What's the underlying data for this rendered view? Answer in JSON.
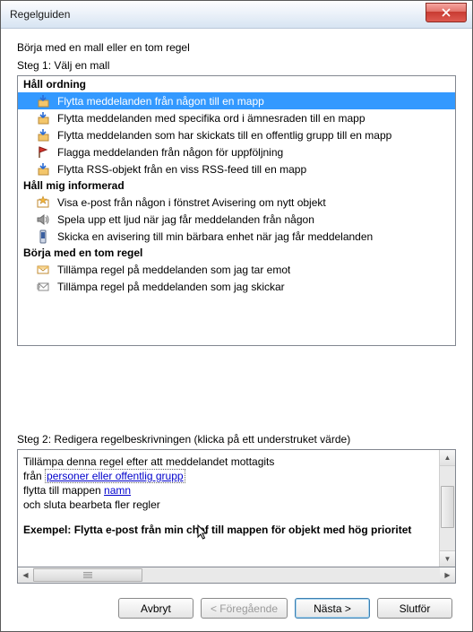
{
  "window": {
    "title": "Regelguiden"
  },
  "intro": "Börja med en mall eller en tom regel",
  "step1_label": "Steg 1: Välj en mall",
  "groups": {
    "g1": "Håll ordning",
    "g2": "Håll mig informerad",
    "g3": "Börja med en tom regel"
  },
  "items": {
    "i1": "Flytta meddelanden från någon till en mapp",
    "i2": "Flytta meddelanden med specifika ord i ämnesraden till en mapp",
    "i3": "Flytta meddelanden som har skickats till en offentlig grupp till en mapp",
    "i4": "Flagga meddelanden från någon för uppföljning",
    "i5": "Flytta RSS-objekt från en viss RSS-feed till en mapp",
    "i6": "Visa e-post från någon i fönstret Avisering om nytt objekt",
    "i7": "Spela upp ett ljud när jag får meddelanden från någon",
    "i8": "Skicka en avisering till min bärbara enhet när jag får meddelanden",
    "i9": "Tillämpa regel på meddelanden som jag tar emot",
    "i10": "Tillämpa regel på meddelanden som jag skickar"
  },
  "step2_label": "Steg 2: Redigera regelbeskrivningen (klicka på ett understruket värde)",
  "desc": {
    "line1": "Tillämpa denna regel efter att meddelandet mottagits",
    "line2_prefix": "från ",
    "line2_link": "personer eller offentlig grupp",
    "line3_prefix": "flytta till mappen ",
    "line3_link": "namn",
    "line4": " och sluta bearbeta fler regler",
    "example": "Exempel: Flytta e-post från min chef till mappen för objekt med hög prioritet"
  },
  "buttons": {
    "cancel": "Avbryt",
    "prev": "< Föregående",
    "next": "Nästa >",
    "finish": "Slutför"
  },
  "colors": {
    "selection": "#3399ff",
    "link": "#0000cc"
  }
}
